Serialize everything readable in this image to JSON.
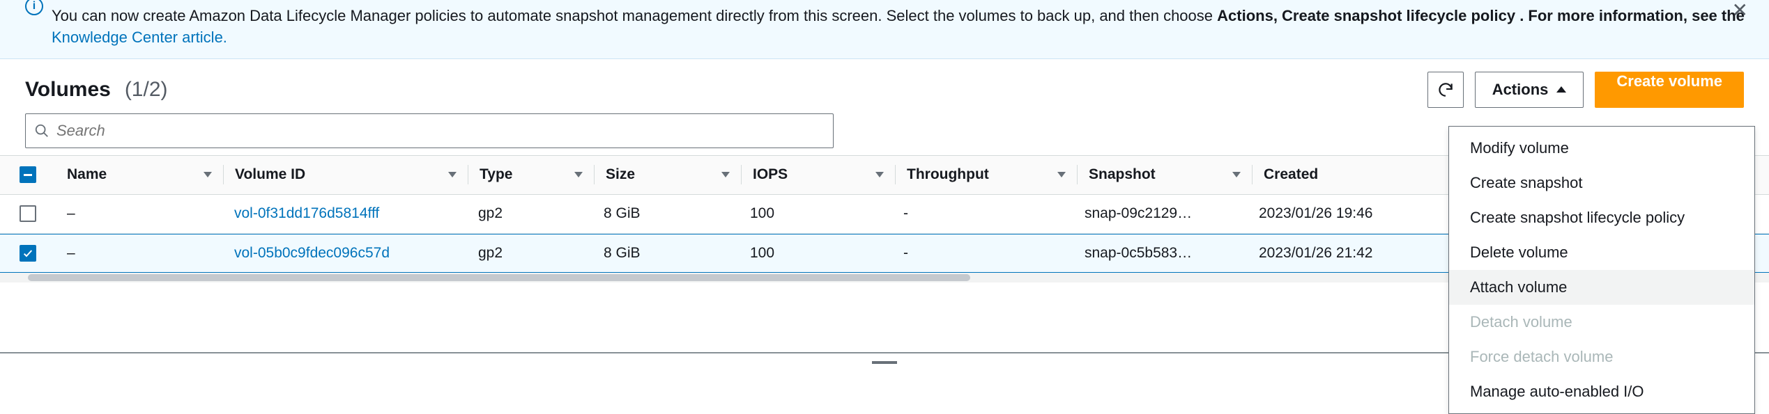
{
  "banner": {
    "line1_prefix": "You can now create Amazon Data Lifecycle Manager policies to automate snapshot management directly from this screen. Select the volumes to back up, and then choose ",
    "line1_bold": "Actions, Create snapshot lifecycle policy",
    "line2_prefix": ". For more information, see the ",
    "link": "Knowledge Center article.",
    "link_href": "#"
  },
  "header": {
    "title": "Volumes",
    "count": "(1/2)",
    "actions_label": "Actions",
    "create_label": "Create volume"
  },
  "search": {
    "placeholder": "Search"
  },
  "columns": {
    "name": "Name",
    "volume_id": "Volume ID",
    "type": "Type",
    "size": "Size",
    "iops": "IOPS",
    "throughput": "Throughput",
    "snapshot": "Snapshot",
    "created": "Created"
  },
  "rows": [
    {
      "selected": false,
      "name": "–",
      "volume_id": "vol-0f31dd176d5814fff",
      "type": "gp2",
      "size": "8 GiB",
      "iops": "100",
      "throughput": "-",
      "snapshot": "snap-09c2129…",
      "created": "2023/01/26 19:46"
    },
    {
      "selected": true,
      "name": "–",
      "volume_id": "vol-05b0c9fdec096c57d",
      "type": "gp2",
      "size": "8 GiB",
      "iops": "100",
      "throughput": "-",
      "snapshot": "snap-0c5b583…",
      "created": "2023/01/26 21:42"
    }
  ],
  "actions_menu": [
    {
      "label": "Modify volume",
      "disabled": false,
      "hover": false
    },
    {
      "label": "Create snapshot",
      "disabled": false,
      "hover": false
    },
    {
      "label": "Create snapshot lifecycle policy",
      "disabled": false,
      "hover": false
    },
    {
      "label": "Delete volume",
      "disabled": false,
      "hover": false
    },
    {
      "label": "Attach volume",
      "disabled": false,
      "hover": true
    },
    {
      "label": "Detach volume",
      "disabled": true,
      "hover": false
    },
    {
      "label": "Force detach volume",
      "disabled": true,
      "hover": false
    },
    {
      "label": "Manage auto-enabled I/O",
      "disabled": false,
      "hover": false
    }
  ]
}
